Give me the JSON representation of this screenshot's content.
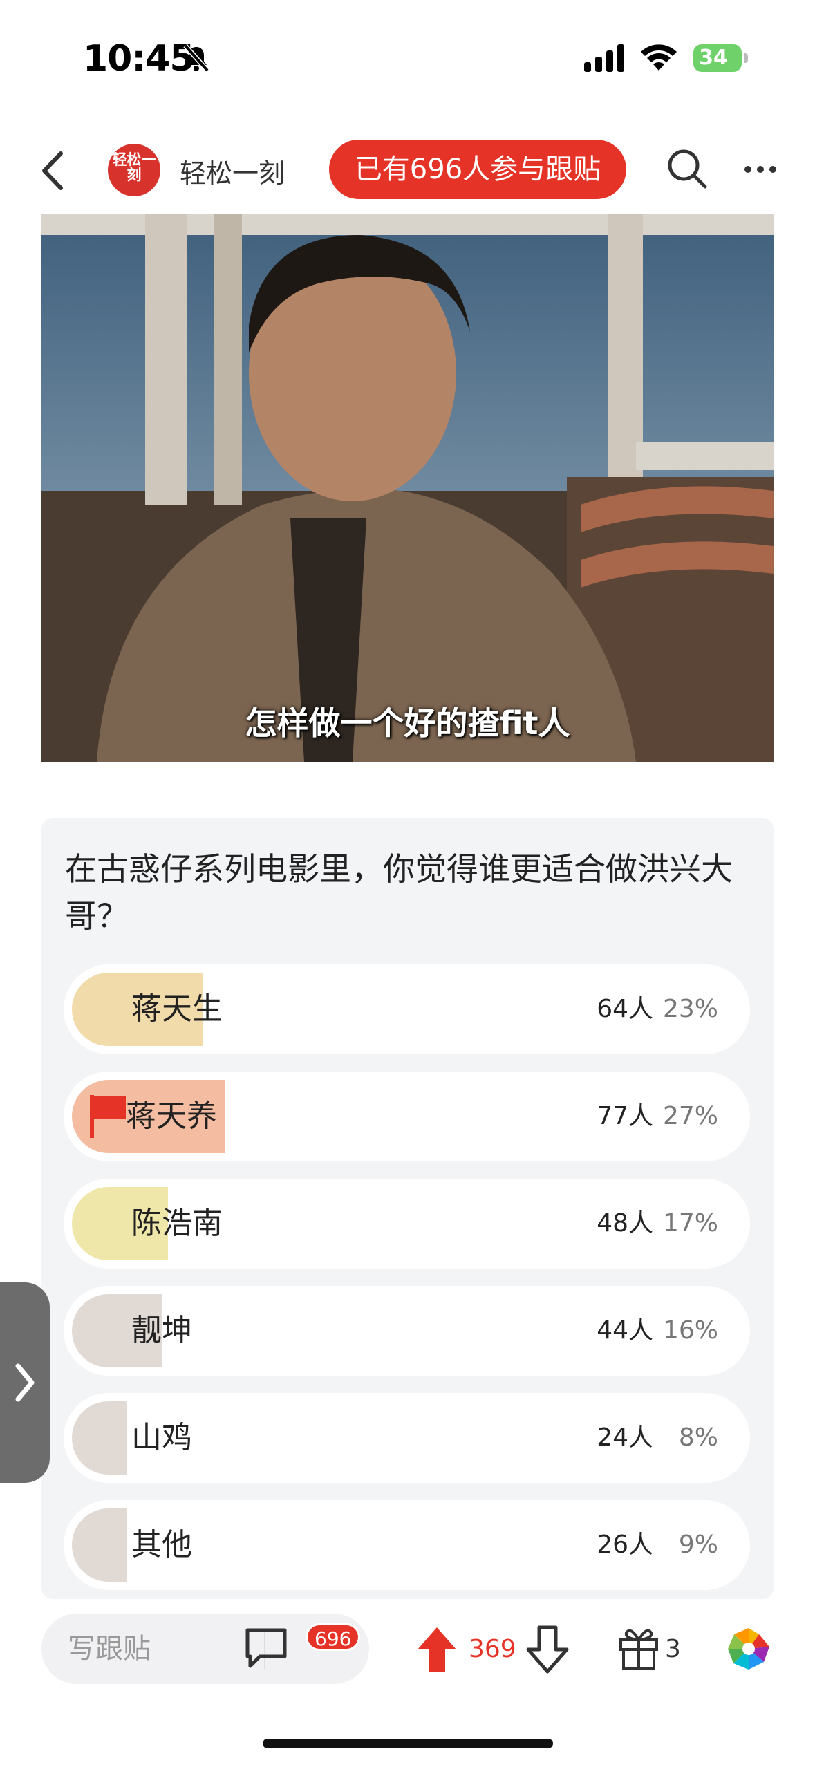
{
  "status_bar": {
    "time": "10:45",
    "battery": "34"
  },
  "nav": {
    "channel_name": "轻松一刻",
    "avatar_text": "轻松一刻",
    "join_label": "已有696人参与跟贴"
  },
  "image": {
    "caption": "怎样做一个好的揸fit人"
  },
  "poll": {
    "question": "在古惑仔系列电影里，你觉得谁更适合做洪兴大哥？",
    "options": [
      {
        "label": "蒋天生",
        "count": "64人",
        "percent": "23%",
        "share": 0.23,
        "color": "#f2dbab",
        "selected": false
      },
      {
        "label": "蒋天养",
        "count": "77人",
        "percent": "27%",
        "share": 0.27,
        "color": "#f4bda1",
        "selected": true
      },
      {
        "label": "陈浩南",
        "count": "48人",
        "percent": "17%",
        "share": 0.17,
        "color": "#efe6a9",
        "selected": false
      },
      {
        "label": "靓坤",
        "count": "44人",
        "percent": "16%",
        "share": 0.16,
        "color": "#e0d9d4",
        "selected": false
      },
      {
        "label": "山鸡",
        "count": "24人",
        "percent": "8%",
        "share": 0.08,
        "color": "#e0d9d4",
        "selected": false
      },
      {
        "label": "其他",
        "count": "26人",
        "percent": "9%",
        "share": 0.09,
        "color": "#e0d9d4",
        "selected": false
      }
    ]
  },
  "bottom_bar": {
    "reply_placeholder": "写跟贴",
    "comment_badge": "696",
    "upvote_count": "369",
    "gift_count": "3"
  },
  "colors": {
    "accent": "#e63327"
  }
}
